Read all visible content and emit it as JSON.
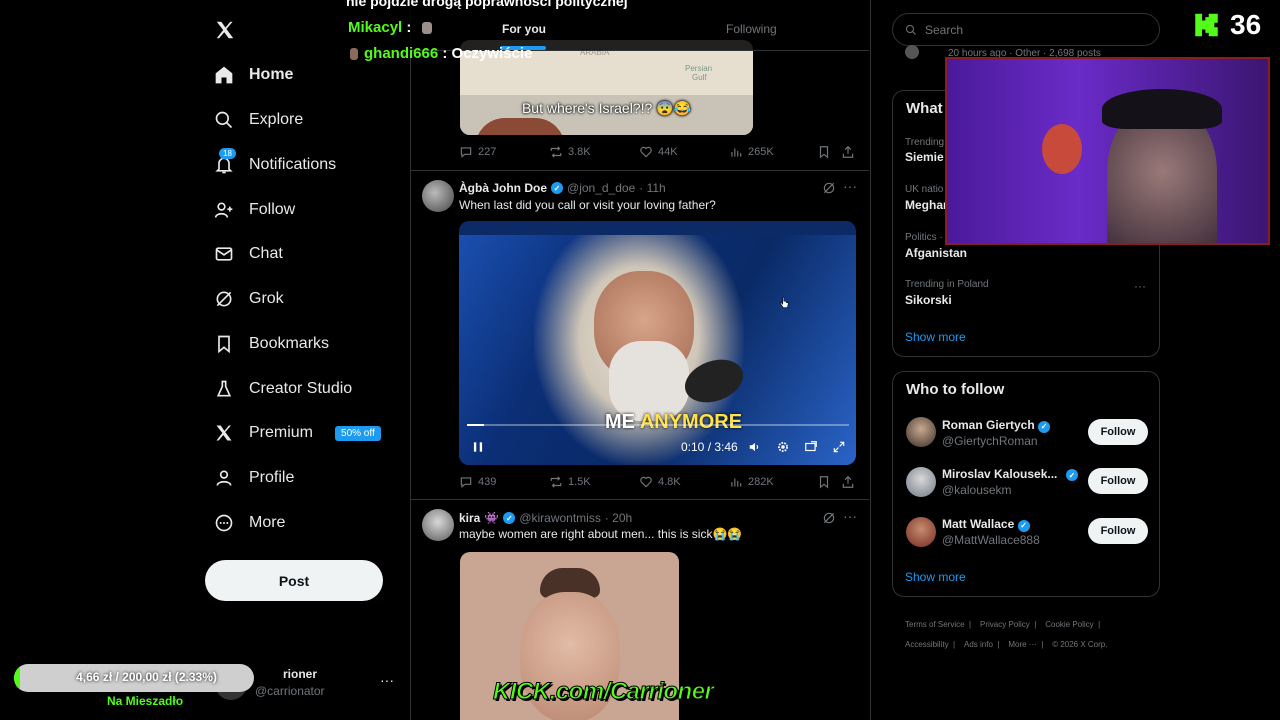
{
  "colors": {
    "accent": "#1d9bf0",
    "kick_green": "#53fc18",
    "bg": "#000000"
  },
  "overlay": {
    "banner_text": "nie pójdzie drogą poprawności politycznej",
    "chat": [
      {
        "user": "Mikacyl",
        "sep": " :",
        "msg": ""
      },
      {
        "user": "ghandi666",
        "sep": " : ",
        "msg": "Oczywiście"
      }
    ],
    "viewer_count": "36",
    "donation": {
      "text": "4,66 zł / 200,00 zł (2.33%)",
      "progress_percent": 2.33,
      "label": "Na Mieszadło"
    },
    "kick_url": "KICK.com/Carrioner"
  },
  "nav": {
    "items": [
      {
        "label": "Home",
        "icon": "home-icon"
      },
      {
        "label": "Explore",
        "icon": "search-icon"
      },
      {
        "label": "Notifications",
        "icon": "bell-icon",
        "badge": "18"
      },
      {
        "label": "Follow",
        "icon": "add-person-icon"
      },
      {
        "label": "Chat",
        "icon": "mail-icon"
      },
      {
        "label": "Grok",
        "icon": "grok-icon"
      },
      {
        "label": "Bookmarks",
        "icon": "bookmark-icon"
      },
      {
        "label": "Creator Studio",
        "icon": "flask-icon"
      },
      {
        "label": "Premium",
        "icon": "x-logo-icon",
        "badge": "50% off"
      },
      {
        "label": "Profile",
        "icon": "person-icon"
      },
      {
        "label": "More",
        "icon": "more-circle-icon"
      }
    ],
    "post_label": "Post",
    "account": {
      "name": "rioner",
      "handle": "@carrionator",
      "more": "···"
    }
  },
  "tabs": {
    "for_you": "For you",
    "following": "Following"
  },
  "tweets": [
    {
      "media_caption": "But where's Israel?!? 😨😂",
      "map_labels": [
        "ARABIA",
        "Persian",
        "Gulf"
      ],
      "stats": {
        "replies": "227",
        "reposts": "3.8K",
        "likes": "44K",
        "views": "265K"
      }
    },
    {
      "name": "Àgbà John Doe",
      "handle": "@jon_d_doe",
      "time": "· 11h",
      "text": "When last did you call or visit your loving father?",
      "video_caption_a": "ME",
      "video_caption_b": "ANYMORE",
      "video_time": "0:10 / 3:46",
      "video_progress": 0.045,
      "stats": {
        "replies": "439",
        "reposts": "1.5K",
        "likes": "4.8K",
        "views": "282K"
      }
    },
    {
      "name": "kira",
      "name_emoji": "👾",
      "handle": "@kirawontmiss",
      "time": "· 20h",
      "text": "maybe women are right about men... this is sick😭😭"
    }
  ],
  "search": {
    "placeholder": "Search"
  },
  "right": {
    "top_meta": "20 hours ago · Other · 2,698 posts",
    "trends_title": "What",
    "trends": [
      {
        "context": "Trending",
        "name": "Siemie"
      },
      {
        "context": "UK natio",
        "name": "Meghan"
      },
      {
        "context": "Politics ·",
        "name": "Afganistan"
      },
      {
        "context": "Trending in Poland",
        "name": "Sikorski"
      }
    ],
    "show_more": "Show more",
    "wtf_title": "Who to follow",
    "wtf": [
      {
        "name": "Roman Giertych",
        "handle": "@GiertychRoman",
        "btn": "Follow"
      },
      {
        "name": "Miroslav Kalousek...",
        "handle": "@kalousekm",
        "btn": "Follow"
      },
      {
        "name": "Matt Wallace",
        "handle": "@MattWallace888",
        "btn": "Follow"
      }
    ],
    "footer": [
      "Terms of Service",
      "Privacy Policy",
      "Cookie Policy",
      "Accessibility",
      "Ads info",
      "More ···",
      "© 2026 X Corp."
    ]
  }
}
